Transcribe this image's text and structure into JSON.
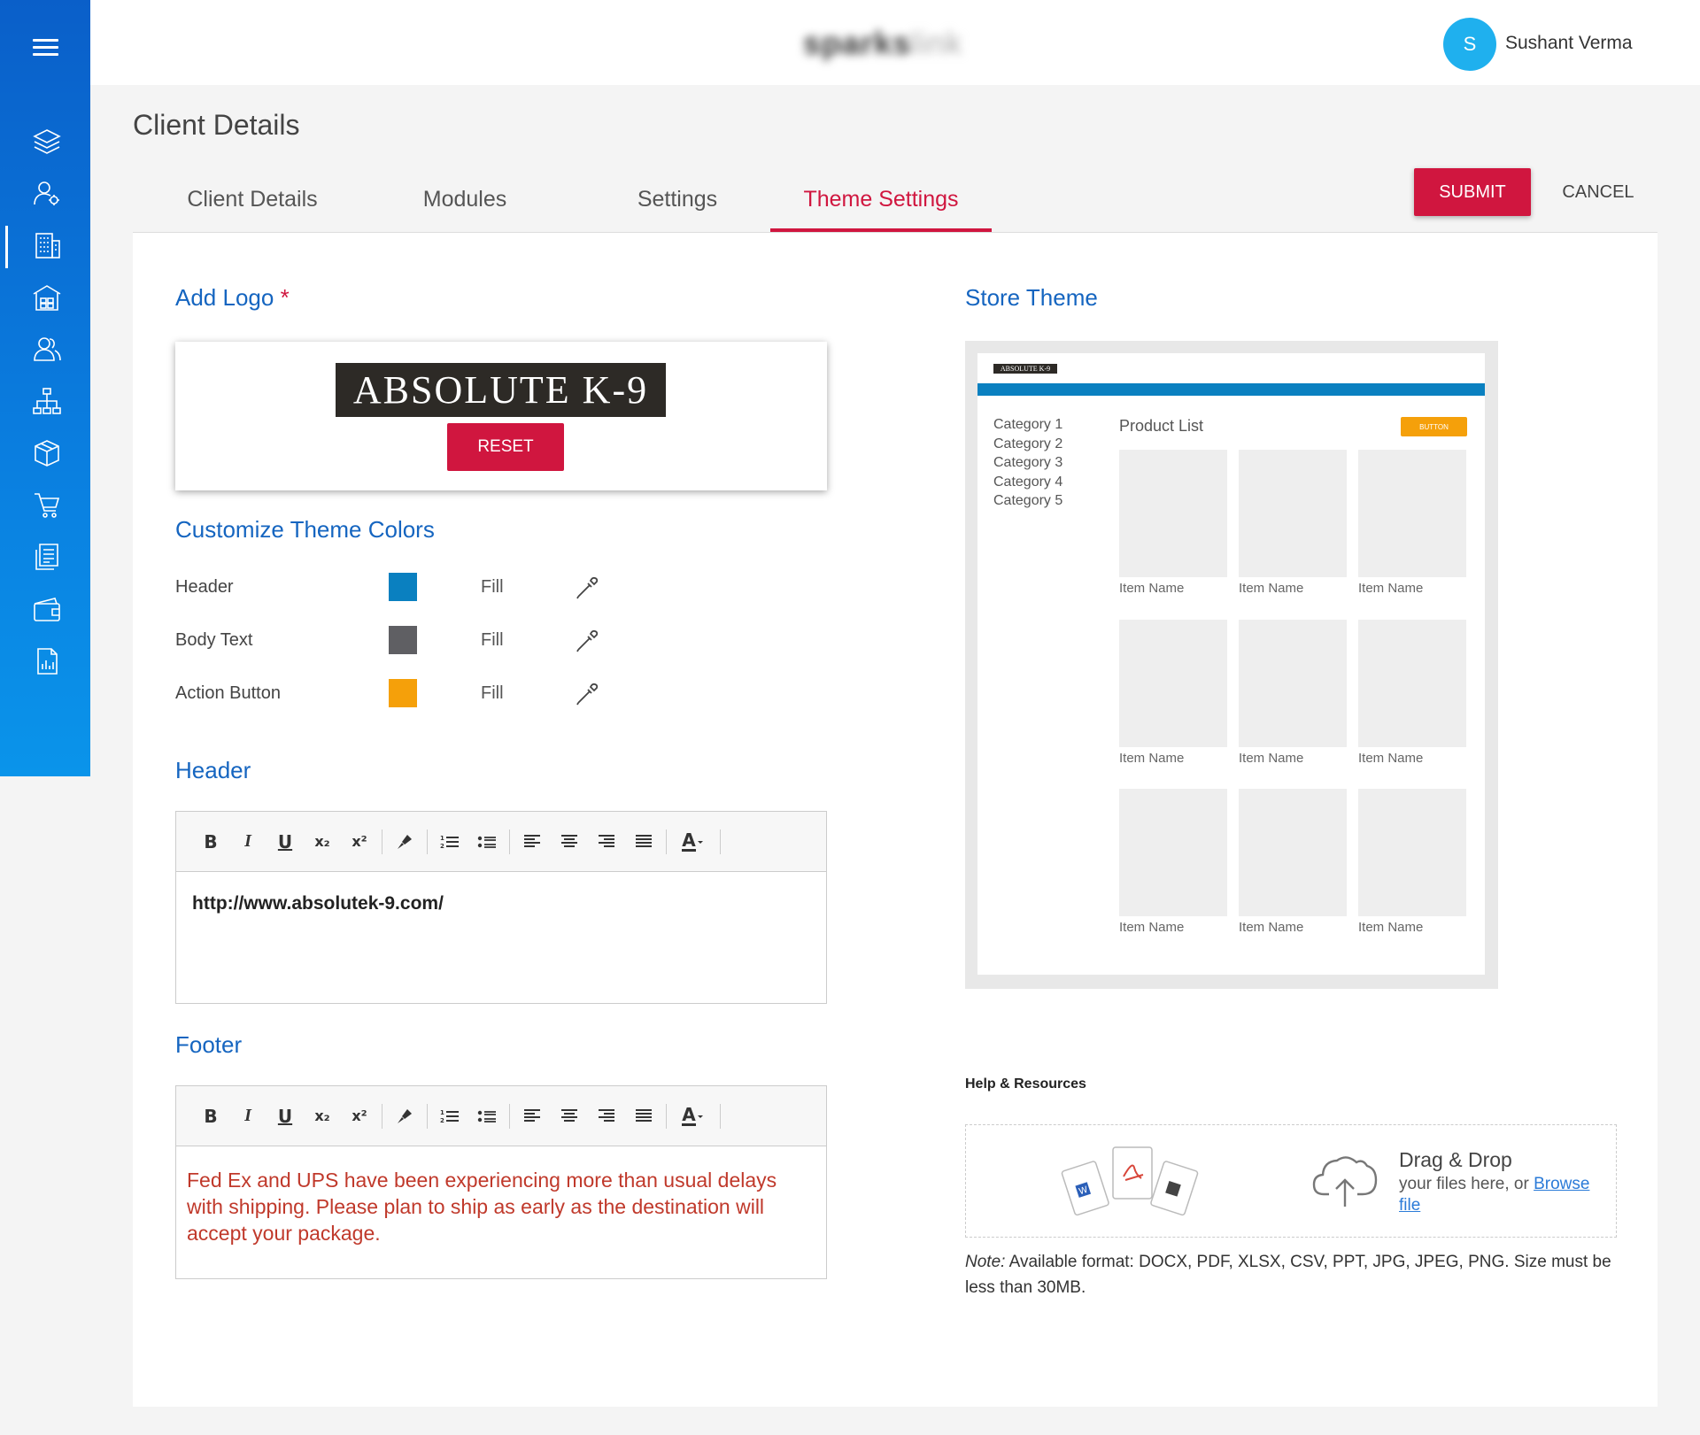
{
  "topbar": {
    "brand_main": "sparks",
    "brand_light": "link",
    "user_initial": "S",
    "user_name": "Sushant Verma"
  },
  "sidebar": {
    "items": [
      "layers-icon",
      "user-settings-icon",
      "building-icon",
      "warehouse-icon",
      "users-icon",
      "org-chart-icon",
      "package-icon",
      "cart-icon",
      "invoice-icon",
      "wallet-icon",
      "report-icon"
    ],
    "active_index": 2
  },
  "page": {
    "title": "Client Details"
  },
  "tabs": [
    {
      "label": "Client Details",
      "active": false
    },
    {
      "label": "Modules",
      "active": false
    },
    {
      "label": "Settings",
      "active": false
    },
    {
      "label": "Theme Settings",
      "active": true
    }
  ],
  "actions": {
    "submit": "SUBMIT",
    "cancel": "CANCEL"
  },
  "logo": {
    "section_title": "Add Logo",
    "required_mark": "*",
    "logo_text": "ABSOLUTE K-9",
    "reset_label": "RESET"
  },
  "theme_colors": {
    "section_title": "Customize Theme Colors",
    "rows": [
      {
        "label": "Header",
        "color": "#0a80c0",
        "fill_label": "Fill"
      },
      {
        "label": "Body Text",
        "color": "#5f5f63",
        "fill_label": "Fill"
      },
      {
        "label": "Action Button",
        "color": "#f5a00a",
        "fill_label": "Fill"
      }
    ]
  },
  "header_editor": {
    "section_title": "Header",
    "content": "http://www.absolutek-9.com/"
  },
  "footer_editor": {
    "section_title": "Footer",
    "content": "Fed Ex and UPS have been experiencing more than usual delays with shipping. Please plan to ship as early as the destination will accept your package."
  },
  "toolbar": {
    "bold": "B",
    "italic": "I",
    "underline": "U",
    "subscript": "x₂",
    "superscript": "x²",
    "font_color": "A"
  },
  "store_theme": {
    "section_title": "Store Theme",
    "logo_text": "ABSOLUTE K-9",
    "categories": [
      "Category 1",
      "Category 2",
      "Category 3",
      "Category 4",
      "Category 5"
    ],
    "product_list_title": "Product List",
    "button_label": "BUTTON",
    "item_name": "Item Name"
  },
  "help": {
    "title": "Help & Resources",
    "drag_drop_title": "Drag & Drop",
    "drag_drop_sub": "your files here, or",
    "browse": "Browse",
    "file": "file",
    "note_label": "Note:",
    "note_text": " Available format: DOCX, PDF, XLSX, CSV, PPT, JPG, JPEG, PNG. Size must be less than 30MB."
  }
}
